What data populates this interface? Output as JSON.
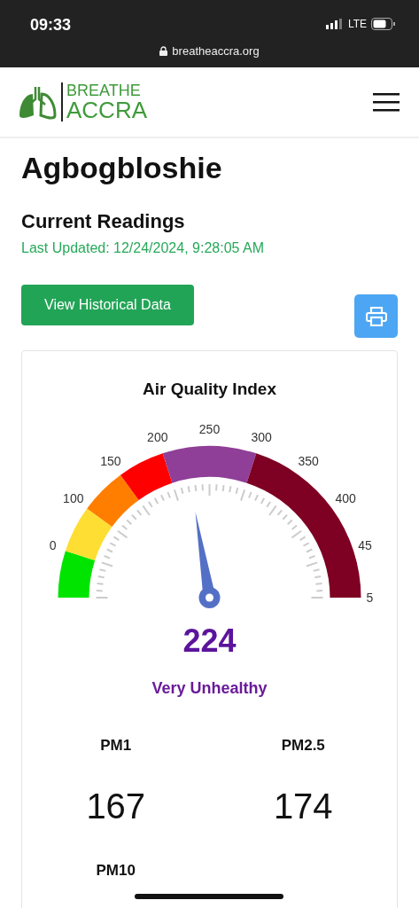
{
  "status_bar": {
    "time": "09:33",
    "network": "LTE",
    "url": "breatheaccra.org"
  },
  "header": {
    "logo_line_1": "BREATHE",
    "logo_line_2": "ACCRA"
  },
  "location": "Agbogbloshie",
  "section_title": "Current Readings",
  "last_updated": "Last Updated: 12/24/2024, 9:28:05 AM",
  "history_button": "View Historical Data",
  "aqi_card": {
    "title": "Air Quality Index",
    "gauge": {
      "bands": [
        {
          "color": "#00e400"
        },
        {
          "color": "#ffde33"
        },
        {
          "color": "#ff7e00"
        },
        {
          "color": "#ff0000"
        },
        {
          "color": "#8f3f97"
        },
        {
          "color": "#7e0023"
        }
      ],
      "tick_labels": [
        {
          "label": "0",
          "kind": "cut_left"
        },
        {
          "label": "100",
          "kind": "full"
        },
        {
          "label": "150",
          "kind": "full"
        },
        {
          "label": "200",
          "kind": "full"
        },
        {
          "label": "250",
          "kind": "full"
        },
        {
          "label": "300",
          "kind": "full"
        },
        {
          "label": "350",
          "kind": "full"
        },
        {
          "label": "400",
          "kind": "full"
        },
        {
          "label": "45",
          "kind": "cut_right"
        },
        {
          "label": "5",
          "kind": "cut_right"
        }
      ]
    },
    "value": "224",
    "category": "Very Unhealthy",
    "pollutants": [
      {
        "name": "PM1",
        "value": "167"
      },
      {
        "name": "PM2.5",
        "value": "174"
      },
      {
        "name": "PM10"
      }
    ]
  }
}
